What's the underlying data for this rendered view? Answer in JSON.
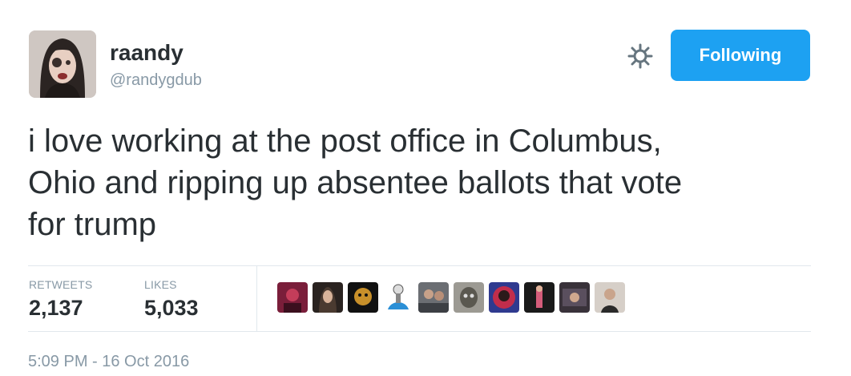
{
  "user": {
    "name": "raandy",
    "handle": "@randygdub"
  },
  "follow_button": {
    "label": "Following"
  },
  "tweet": {
    "lines": [
      "i love working at the post office in Columbus,",
      "Ohio and ripping up absentee ballots that vote",
      "for trump"
    ]
  },
  "stats": {
    "retweets_label": "RETWEETS",
    "retweets_value": "2,137",
    "likes_label": "LIKES",
    "likes_value": "5,033"
  },
  "timestamp": "5:09 PM - 16 Oct 2016",
  "colors": {
    "accent": "#1da1f2",
    "muted": "#8899a6",
    "text": "#292f33"
  },
  "icons": {
    "settings": "gear-icon"
  }
}
